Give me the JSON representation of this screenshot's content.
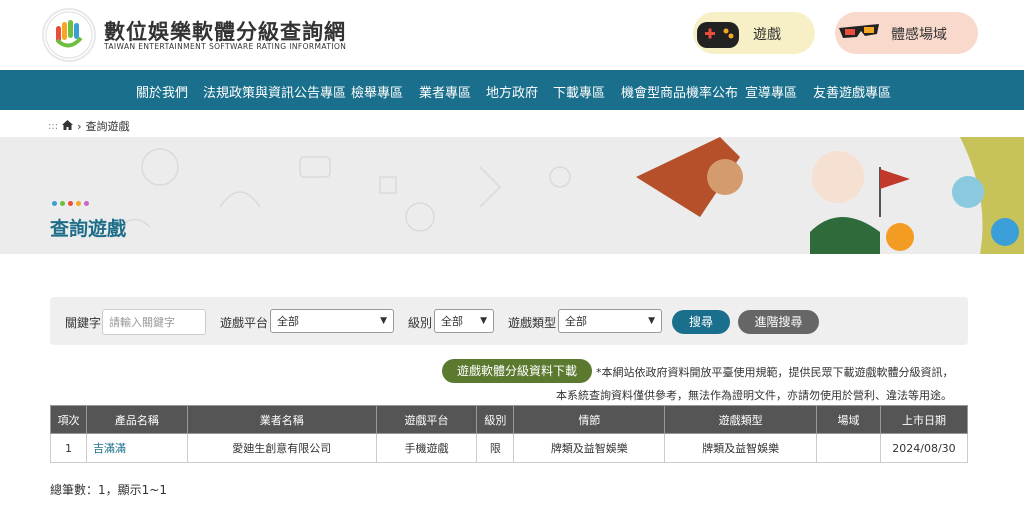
{
  "site": {
    "title": "數位娛樂軟體分級查詢網",
    "subtitle": "TAIWAN ENTERTAINMENT SOFTWARE RATING INFORMATION"
  },
  "top_links": [
    {
      "label": "遊戲",
      "icon": "gamepad-icon"
    },
    {
      "label": "體感場域",
      "icon": "3d-glasses-icon"
    }
  ],
  "nav": [
    "關於我們",
    "法規政策與資訊公告專區",
    "檢舉專區",
    "業者專區",
    "地方政府",
    "下載專區",
    "機會型商品機率公布",
    "宣導專區",
    "友善遊戲專區"
  ],
  "breadcrumb": {
    "prefix": ":::",
    "home_icon": "home-icon",
    "current": "查詢遊戲"
  },
  "banner": {
    "title": "查詢遊戲",
    "dot_colors": [
      "#3a9fd6",
      "#6cbf3f",
      "#e94e3c",
      "#f5a623",
      "#c6c"
    ]
  },
  "search": {
    "keyword_label": "關鍵字",
    "keyword_placeholder": "請輸入關鍵字",
    "platform_label": "遊戲平台",
    "platform_value": "全部",
    "rating_label": "級別",
    "rating_value": "全部",
    "type_label": "遊戲類型",
    "type_value": "全部",
    "search_button": "搜尋",
    "advanced_button": "進階搜尋"
  },
  "download": {
    "button": "遊戲軟體分級資料下載",
    "notice1": "*本網站依政府資料開放平臺使用規範，提供民眾下載遊戲軟體分級資訊，",
    "notice2": "本系統查詢資料僅供參考，無法作為證明文件，亦請勿使用於營利、違法等用途。"
  },
  "table": {
    "headers": [
      "項次",
      "產品名稱",
      "業者名稱",
      "遊戲平台",
      "級別",
      "情節",
      "遊戲類型",
      "場域",
      "上市日期"
    ],
    "rows": [
      [
        "1",
        "吉滿滿",
        "愛廸生創意有限公司",
        "手機遊戲",
        "限",
        "牌類及益智娛樂",
        "牌類及益智娛樂",
        "",
        "2024/08/30"
      ]
    ]
  },
  "summary": "總筆數：1，顯示1~1",
  "colors": {
    "nav": "#1a6f8c",
    "accent": "#1f6f8b",
    "download": "#5c7a2f"
  }
}
